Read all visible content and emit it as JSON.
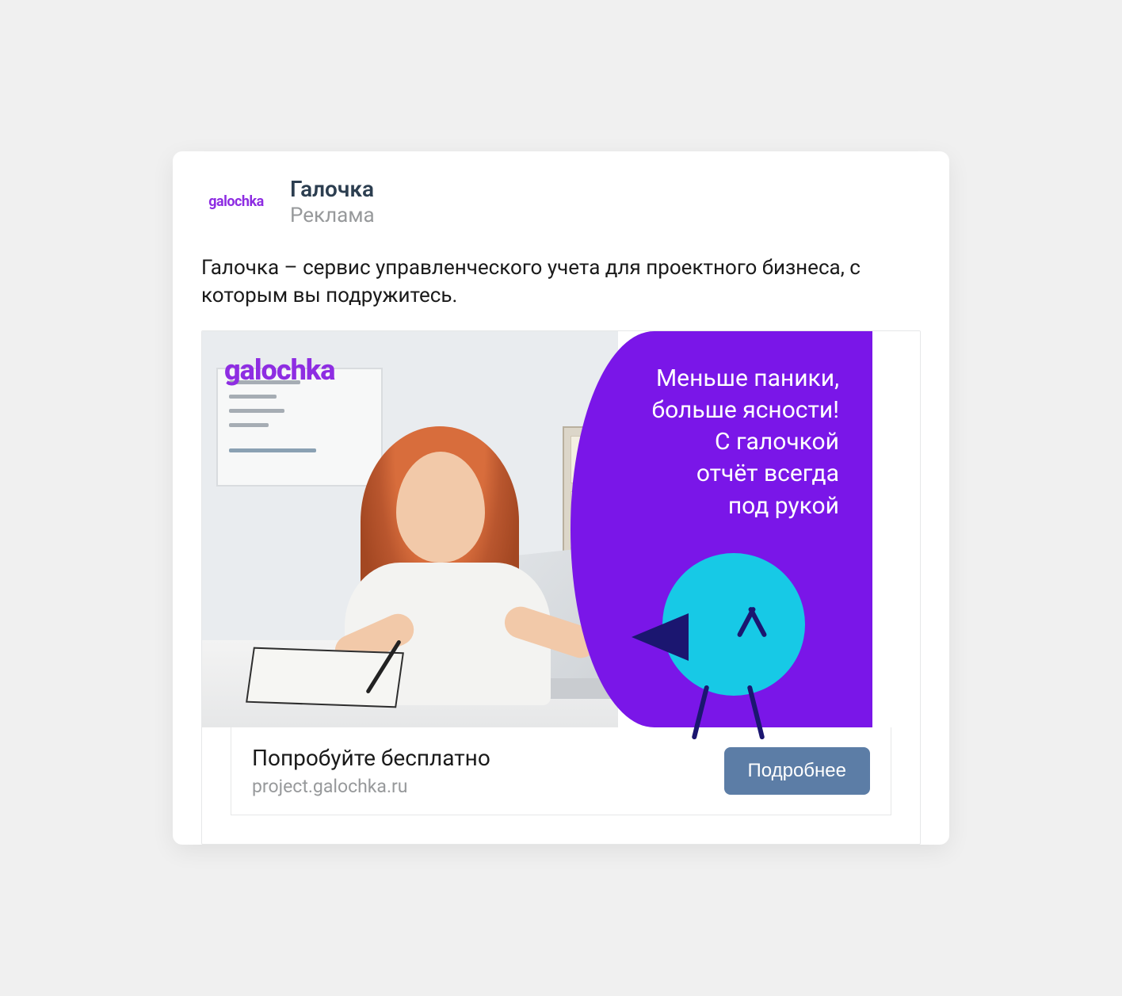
{
  "header": {
    "avatar_logo_text": "galochka",
    "title": "Галочка",
    "subtitle": "Реклама"
  },
  "body_text": "Галочка – сервис управленческого учета для проектного бизнеса, с которым вы подружитесь.",
  "creative": {
    "brand_overlay": "galochka",
    "slogan": "Меньше паники,\nбольше ясности!\nС галочкой\nотчёт всегда\nпод рукой",
    "colors": {
      "brand_purple": "#8e2de2",
      "panel_purple": "#7a16e8",
      "bird_body": "#17c9e6",
      "bird_dark": "#1b1670"
    }
  },
  "cta": {
    "title": "Попробуйте бесплатно",
    "domain": "project.galochka.ru",
    "button_label": "Подробнее"
  }
}
